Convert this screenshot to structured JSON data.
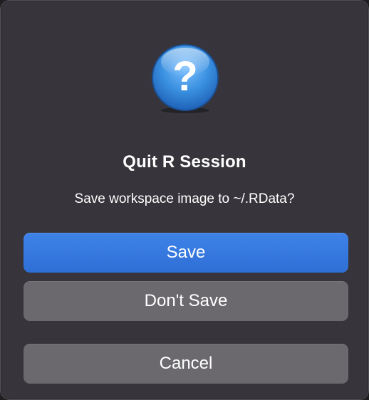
{
  "dialog": {
    "icon": "question-mark-icon",
    "title": "Quit R Session",
    "message": "Save workspace image to ~/.RData?",
    "buttons": {
      "save": "Save",
      "dont_save": "Don't Save",
      "cancel": "Cancel"
    },
    "colors": {
      "background": "#37353b",
      "primary_button": "#3478e0",
      "secondary_button": "#6b696e",
      "icon_blue": "#3a90e0"
    }
  }
}
